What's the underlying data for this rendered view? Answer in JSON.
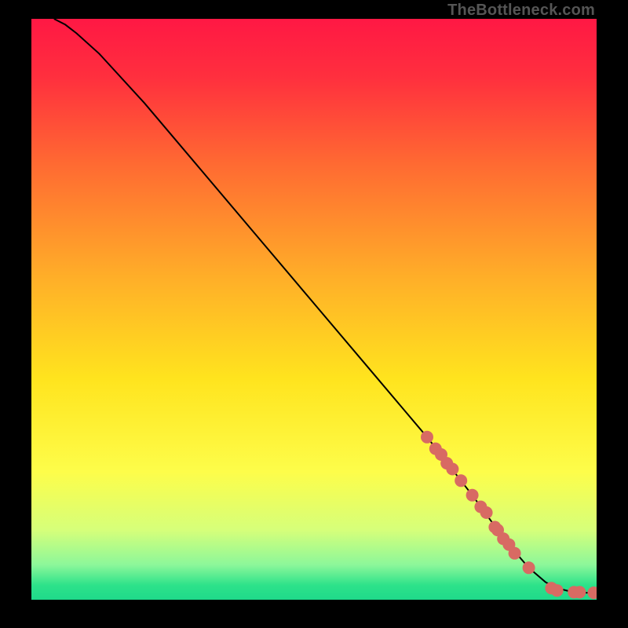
{
  "watermark": "TheBottleneck.com",
  "chart_data": {
    "type": "line",
    "title": "",
    "xlabel": "",
    "ylabel": "",
    "xlim": [
      0,
      100
    ],
    "ylim": [
      0,
      100
    ],
    "series": [
      {
        "name": "curve",
        "x": [
          4,
          6,
          8,
          12,
          20,
          30,
          40,
          50,
          60,
          70,
          78,
          84,
          88,
          91,
          93,
          95,
          98,
          100
        ],
        "y": [
          100,
          99,
          97.5,
          94,
          85.5,
          74,
          62.5,
          51,
          39.5,
          28,
          18,
          10,
          5.5,
          3,
          2,
          1.5,
          1.2,
          1.2
        ]
      }
    ],
    "points": {
      "name": "markers",
      "x": [
        70,
        71.5,
        72.5,
        73.5,
        74.5,
        76,
        78,
        79.5,
        80.5,
        82,
        82.5,
        83.5,
        84.5,
        85.5,
        88,
        92,
        93,
        96,
        97,
        99.5
      ],
      "y": [
        28,
        26,
        25,
        23.5,
        22.5,
        20.5,
        18,
        16,
        15,
        12.5,
        12,
        10.5,
        9.5,
        8,
        5.5,
        2,
        1.6,
        1.3,
        1.3,
        1.2
      ]
    },
    "gradient_stops": [
      {
        "offset": 0,
        "color": "#ff1844"
      },
      {
        "offset": 0.1,
        "color": "#ff2f3e"
      },
      {
        "offset": 0.25,
        "color": "#ff6a32"
      },
      {
        "offset": 0.45,
        "color": "#ffb028"
      },
      {
        "offset": 0.62,
        "color": "#ffe41e"
      },
      {
        "offset": 0.78,
        "color": "#fdfd4a"
      },
      {
        "offset": 0.88,
        "color": "#d6ff7a"
      },
      {
        "offset": 0.94,
        "color": "#8cf79a"
      },
      {
        "offset": 0.975,
        "color": "#2de28a"
      },
      {
        "offset": 1.0,
        "color": "#1fd98a"
      }
    ],
    "marker_color": "#d86a63",
    "curve_color": "#000000"
  }
}
